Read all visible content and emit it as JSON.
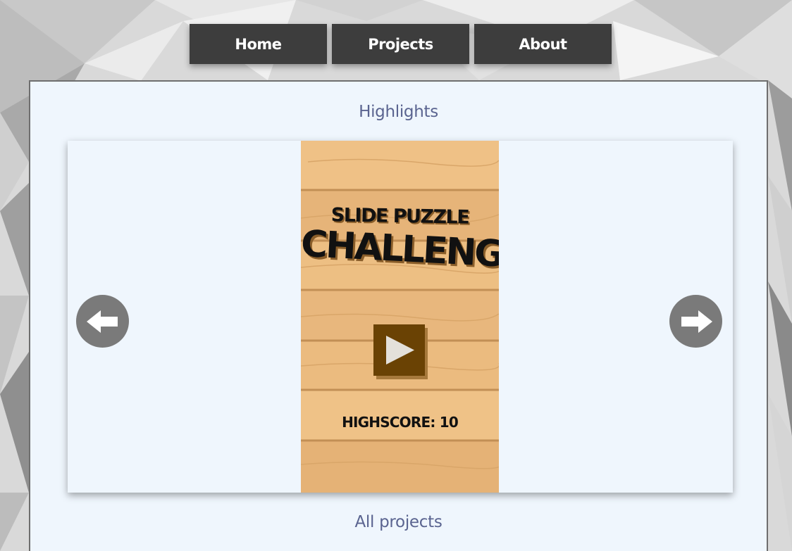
{
  "nav": {
    "items": [
      {
        "label": "Home"
      },
      {
        "label": "Projects"
      },
      {
        "label": "About"
      }
    ]
  },
  "main": {
    "highlights_title": "Highlights",
    "all_projects_title": "All projects"
  },
  "carousel": {
    "slide": {
      "subtitle": "SLIDE PUZZLE",
      "title": "CHALLENGE",
      "highscore": "HIGHSCORE: 10"
    }
  },
  "colors": {
    "nav_bg": "#3d3d3d",
    "panel_bg": "#eff6fd",
    "title_color": "#5a6490",
    "arrow_bg": "#7a7a7a",
    "wood": "#e9b87c",
    "play_bg": "#6a4204"
  },
  "icons": {
    "prev": "arrow-left-icon",
    "next": "arrow-right-icon",
    "play": "play-icon"
  }
}
